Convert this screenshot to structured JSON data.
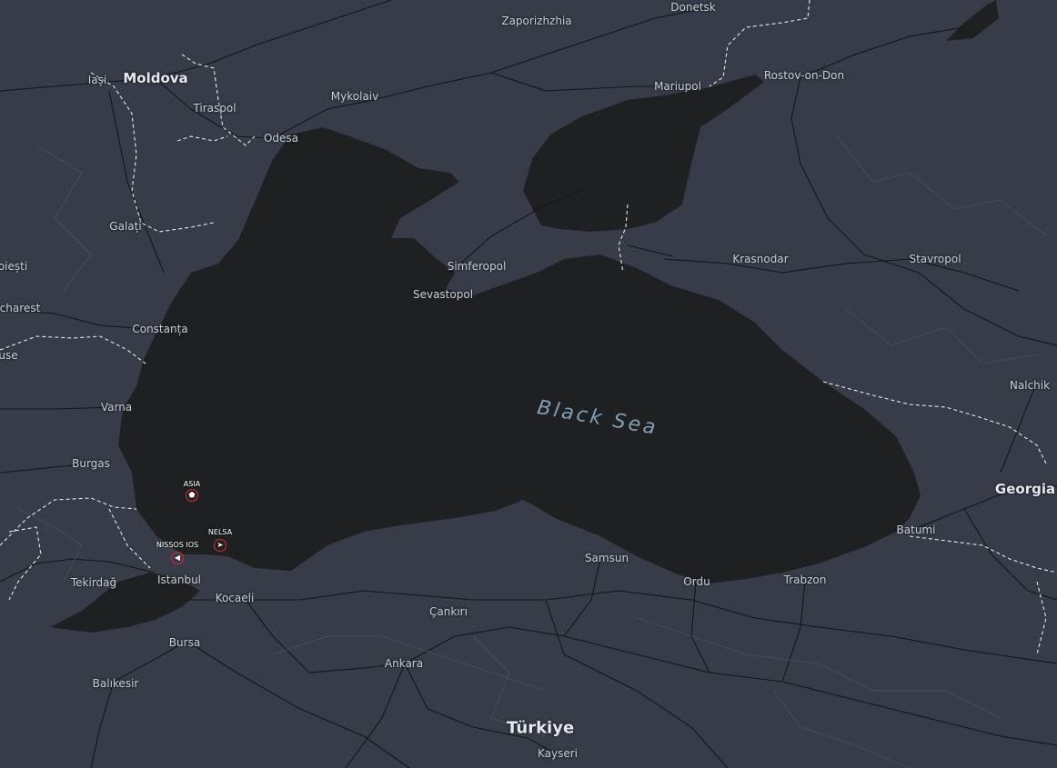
{
  "map": {
    "colors": {
      "land": "#373c48",
      "sea": "#1f2022",
      "road": "#14161a",
      "border": "#e8e8e8",
      "sea_label": "#7f9fb5",
      "vessel_ring": "#e0242c"
    }
  },
  "labels": {
    "sea": "Black Sea",
    "countries": {
      "moldova": "Moldova",
      "turkiye": "Türkiye",
      "georgia": "Georgia"
    },
    "cities": {
      "zaporizhzhia": "Zaporizhzhia",
      "donetsk": "Donetsk",
      "iasi": "Iași",
      "tiraspol": "Tiraspol",
      "mykolaiv": "Mykolaiv",
      "odesa": "Odesa",
      "mariupol": "Mariupol",
      "rostov": "Rostov-on-Don",
      "galati": "Galați",
      "ploiesti": "oiești",
      "bucharest": "charest",
      "ruse": "use",
      "simferopol": "Simferopol",
      "sevastopol": "Sevastopol",
      "krasnodar": "Krasnodar",
      "stavropol": "Stavropol",
      "constanta": "Constanța",
      "varna": "Varna",
      "burgas": "Burgas",
      "nalchik": "Nalchik",
      "batumi": "Batumi",
      "samsun": "Samsun",
      "ordu": "Ordu",
      "trabzon": "Trabzon",
      "tekirdag": "Tekirdağ",
      "istanbul": "Istanbul",
      "kocaeli": "Kocaeli",
      "cankiri": "Çankırı",
      "bursa": "Bursa",
      "ankara": "Ankara",
      "balikesir": "Balıkesir",
      "kayseri": "Kayseri"
    }
  },
  "vessels": [
    {
      "name": "ASIA",
      "icon": "ship-icon",
      "glyph": "⬟"
    },
    {
      "name": "NELSA",
      "icon": "ship-arrow-icon",
      "glyph": "➤"
    },
    {
      "name": "NISSOS IOS",
      "icon": "ship-icon",
      "glyph": "◀"
    }
  ]
}
